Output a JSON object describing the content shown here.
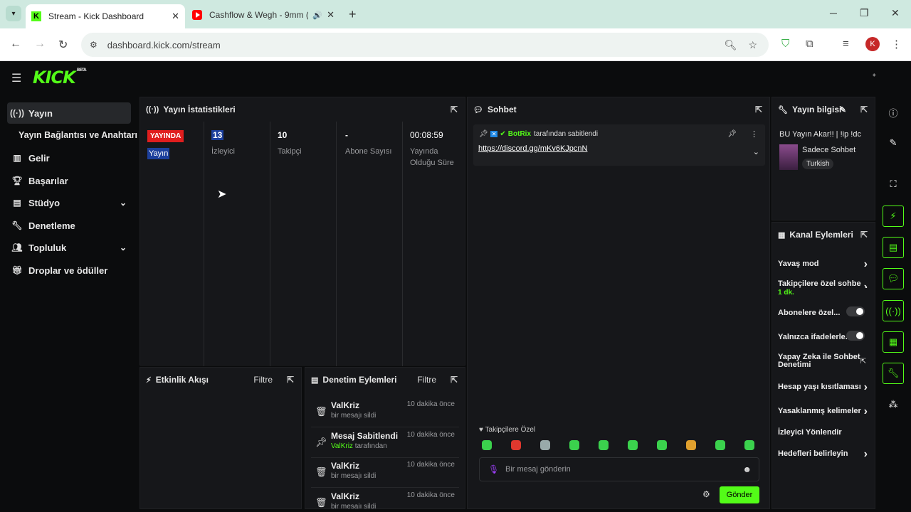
{
  "browser": {
    "tabs": [
      {
        "title": "Stream - Kick Dashboard",
        "active": true
      },
      {
        "title": "Cashflow & Wegh - 9mm (",
        "active": false
      }
    ],
    "url": "dashboard.kick.com/stream",
    "profile_initial": "K"
  },
  "header": {
    "logo": "KICK",
    "logo_badge": "BETA"
  },
  "sidebar": {
    "items": [
      {
        "label": "Yayın",
        "icon": "broadcast-icon"
      },
      {
        "label": "Yayın Bağlantısı ve Anahtarı"
      },
      {
        "label": "Gelir",
        "icon": "chart-icon"
      },
      {
        "label": "Başarılar",
        "icon": "trophy-icon"
      },
      {
        "label": "Stüdyo",
        "icon": "studio-icon"
      },
      {
        "label": "Denetleme",
        "icon": "wrench-icon"
      },
      {
        "label": "Topluluk",
        "icon": "community-icon"
      },
      {
        "label": "Droplar ve ödüller",
        "icon": "gift-icon"
      }
    ]
  },
  "stats": {
    "title": "Yayın İstatistikleri",
    "live_badge": "YAYINDA",
    "status_label": "Yayın",
    "viewers": {
      "value": "13",
      "label": "İzleyici"
    },
    "followers": {
      "value": "10",
      "label": "Takipçi"
    },
    "subs": {
      "value": "-",
      "label": "Abone Sayısı"
    },
    "uptime": {
      "value": "00:08:59",
      "label": "Yayında Olduğu Süre"
    }
  },
  "activity": {
    "title": "Etkinlik Akışı",
    "filter": "Filtre"
  },
  "moderation": {
    "title": "Denetim Eylemleri",
    "filter": "Filtre",
    "items": [
      {
        "icon": "trash-icon",
        "name": "ValKriz",
        "sub": "bir mesajı sildi",
        "time": "10 dakika önce"
      },
      {
        "icon": "pin-icon",
        "name": "Mesaj Sabitlendi",
        "sub_user": "ValKriz",
        "sub": "tarafından",
        "time": "10 dakika önce"
      },
      {
        "icon": "trash-icon",
        "name": "ValKriz",
        "sub": "bir mesajı sildi",
        "time": "10 dakika önce"
      },
      {
        "icon": "trash-icon",
        "name": "ValKriz",
        "sub": "bir mesajı sildi",
        "time": "10 dakika önce"
      }
    ]
  },
  "chat": {
    "title": "Sohbet",
    "pinned_user": "BotRix",
    "pinned_text": "tarafından sabitlendi",
    "pinned_link": "https://discord.gg/mKv6KJpcnN",
    "followers_only": "Takipçilere Özel",
    "input_placeholder": "Bir mesaj gönderin",
    "send": "Gönder",
    "emote_colors": [
      "#3bd24d",
      "#e0382e",
      "#9aa",
      "#3bd24d",
      "#3bd24d",
      "#3bd24d",
      "#3bd24d",
      "#e0a02e",
      "#3bd24d",
      "#3bd24d"
    ]
  },
  "stream_info": {
    "title": "Yayın bilgisi",
    "stream_title": "BU Yayın Akar!! | !ip !dc",
    "category": "Sadece Sohbet",
    "language": "Turkish"
  },
  "channel_actions": {
    "title": "Kanal Eylemleri",
    "items": [
      {
        "label": "Yavaş mod",
        "control": "arrow"
      },
      {
        "label": "Takipçilere özel sohbe",
        "sub": "1 dk.",
        "control": "arrow"
      },
      {
        "label": "Abonelere özel...",
        "control": "toggle"
      },
      {
        "label": "Yalnızca ifadelerle...",
        "control": "toggle"
      },
      {
        "label": "Yapay Zeka ile Sohbet Denetimi",
        "control": "external"
      },
      {
        "label": "Hesap yaşı kısıtlaması",
        "control": "arrow"
      },
      {
        "label": "Yasaklanmış kelimeler",
        "control": "arrow"
      },
      {
        "label": "İzleyici Yönlendir",
        "control": "none"
      },
      {
        "label": "Hedefleri belirleyin",
        "control": "arrow"
      }
    ]
  },
  "colors": {
    "brand": "#53fc18",
    "live": "#e01e1e",
    "bg": "#0b0c0d",
    "panel": "#16171a"
  }
}
